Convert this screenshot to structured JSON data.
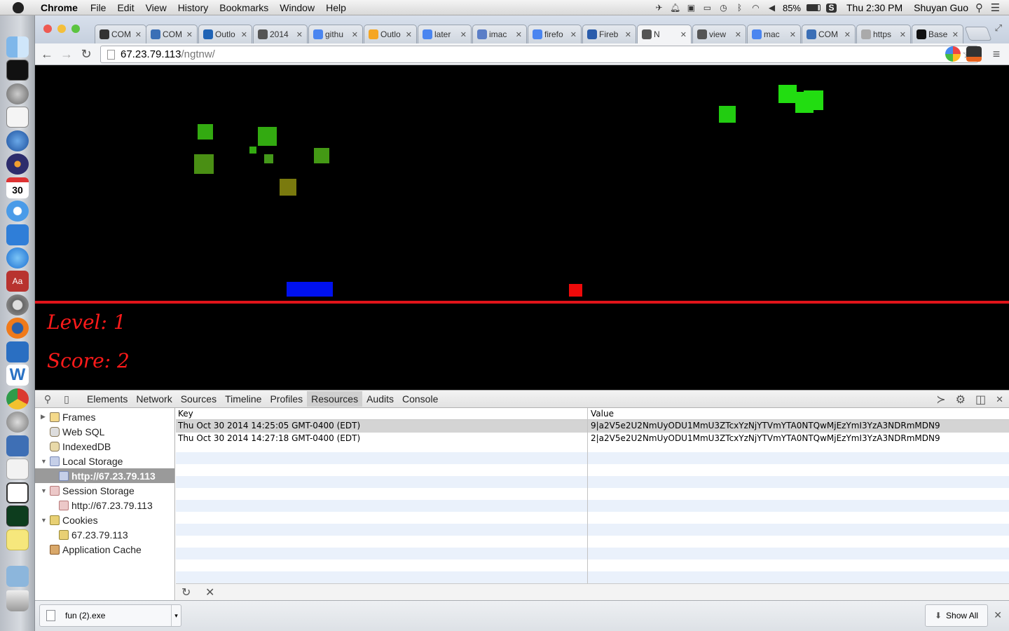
{
  "menubar": {
    "app_name": "Chrome",
    "menus": [
      "File",
      "Edit",
      "View",
      "History",
      "Bookmarks",
      "Window",
      "Help"
    ],
    "battery": "85%",
    "clock": "Thu 2:30 PM",
    "user": "Shuyan Guo"
  },
  "tabs": [
    {
      "label": "COM",
      "icon": "github-icon",
      "color": "#333333"
    },
    {
      "label": "COM",
      "icon": "p-icon",
      "color": "#3b6fb6"
    },
    {
      "label": "Outlo",
      "icon": "outlook-icon",
      "color": "#1f63b5"
    },
    {
      "label": "2014",
      "icon": "x-icon",
      "color": "#555555"
    },
    {
      "label": "githu",
      "icon": "google-icon",
      "color": "#4a85f0"
    },
    {
      "label": "Outlo",
      "icon": "outlook-icon",
      "color": "#f5a623"
    },
    {
      "label": "later",
      "icon": "google-icon",
      "color": "#4a85f0"
    },
    {
      "label": "imac",
      "icon": "m-icon",
      "color": "#5b7ec7"
    },
    {
      "label": "firefo",
      "icon": "google-icon",
      "color": "#4a85f0"
    },
    {
      "label": "Fireb",
      "icon": "css-icon",
      "color": "#2a5cab"
    },
    {
      "label": "N",
      "icon": "x-icon",
      "color": "#555555",
      "active": true
    },
    {
      "label": "view",
      "icon": "x-icon",
      "color": "#555555"
    },
    {
      "label": "mac",
      "icon": "google-icon",
      "color": "#4a85f0"
    },
    {
      "label": "COM",
      "icon": "p-icon",
      "color": "#3b6fb6"
    },
    {
      "label": "https",
      "icon": "page-icon",
      "color": "#aaaaaa"
    },
    {
      "label": "Base",
      "icon": "base64-icon",
      "color": "#111111"
    }
  ],
  "address": {
    "host": "67.23.79.113",
    "path": "/ngtnw/"
  },
  "game": {
    "level_text": "Level: 1",
    "score_text": "Score: 2",
    "colors": {
      "background": "#000000",
      "divider": "#e0141a",
      "hud_text": "#ff1a1a",
      "player": "#0011ee",
      "red_block": "#ee0a0a"
    }
  },
  "devtools": {
    "tabs": [
      "Elements",
      "Network",
      "Sources",
      "Timeline",
      "Profiles",
      "Resources",
      "Audits",
      "Console"
    ],
    "selected_tab": "Resources",
    "sidebar": {
      "frames": "Frames",
      "web_sql": "Web SQL",
      "indexeddb": "IndexedDB",
      "local_storage": "Local Storage",
      "local_storage_origin": "http://67.23.79.113",
      "session_storage": "Session Storage",
      "session_storage_origin": "http://67.23.79.113",
      "cookies": "Cookies",
      "cookies_domain": "67.23.79.113",
      "app_cache": "Application Cache"
    },
    "table": {
      "headers": {
        "key": "Key",
        "value": "Value"
      },
      "rows": [
        {
          "key": "Thu Oct 30 2014 14:25:05 GMT-0400 (EDT)",
          "value": "9|a2V5e2U2NmUyODU1MmU3ZTcxYzNjYTVmYTA0NTQwMjEzYmI3YzA3NDRmMDN9"
        },
        {
          "key": "Thu Oct 30 2014 14:27:18 GMT-0400 (EDT)",
          "value": "2|a2V5e2U2NmUyODU1MmU3ZTcxYzNjYTVmYTA0NTQwMjEzYmI3YzA3NDRmMDN9"
        }
      ]
    }
  },
  "downloads": {
    "file_name": "fun (2).exe",
    "show_all": "Show All"
  }
}
